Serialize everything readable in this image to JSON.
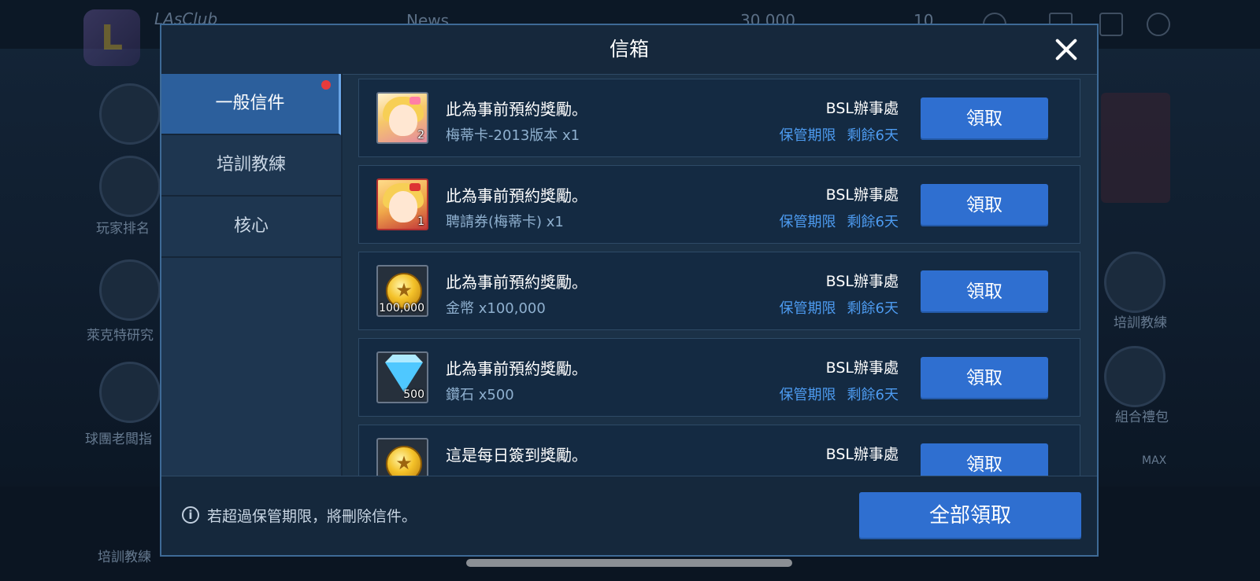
{
  "background": {
    "club_name": "LAsClub",
    "news_label": "News",
    "coins_value": "30,000",
    "gems_value": "10",
    "left_menu": [
      "玩家排名",
      "萊克特研究",
      "球團老闆指"
    ],
    "right_menu": [
      "培訓教練",
      "組合禮包"
    ],
    "bottom_menu": [
      "培訓教練"
    ],
    "max_badge": "MAX"
  },
  "modal": {
    "title": "信箱",
    "tabs": [
      {
        "label": "一般信件",
        "active": true,
        "has_notification": true
      },
      {
        "label": "培訓教練",
        "active": false,
        "has_notification": false
      },
      {
        "label": "核心",
        "active": false,
        "has_notification": false
      }
    ],
    "mails": [
      {
        "icon": "character-card-icon",
        "title": "此為事前預約獎勵。",
        "item": "梅蒂卡-2013版本 x1",
        "quantity_badge": "2",
        "sender": "BSL辦事處",
        "expiry_label": "保管期限",
        "expiry_remaining": "剩餘6天",
        "claim_label": "領取"
      },
      {
        "icon": "recruit-ticket-icon",
        "title": "此為事前預約獎勵。",
        "item": "聘請券(梅蒂卡) x1",
        "quantity_badge": "1",
        "sender": "BSL辦事處",
        "expiry_label": "保管期限",
        "expiry_remaining": "剩餘6天",
        "claim_label": "領取"
      },
      {
        "icon": "gold-coin-icon",
        "title": "此為事前預約獎勵。",
        "item": "金幣 x100,000",
        "quantity_badge": "100,000",
        "sender": "BSL辦事處",
        "expiry_label": "保管期限",
        "expiry_remaining": "剩餘6天",
        "claim_label": "領取"
      },
      {
        "icon": "diamond-icon",
        "title": "此為事前預約獎勵。",
        "item": "鑽石 x500",
        "quantity_badge": "500",
        "sender": "BSL辦事處",
        "expiry_label": "保管期限",
        "expiry_remaining": "剩餘6天",
        "claim_label": "領取"
      },
      {
        "icon": "gold-coin-icon",
        "title": "這是每日簽到獎勵。",
        "item": "",
        "quantity_badge": "",
        "sender": "BSL辦事處",
        "expiry_label": "",
        "expiry_remaining": "",
        "claim_label": "領取"
      }
    ],
    "footer_note": "若超過保管期限，將刪除信件。",
    "claim_all_label": "全部領取",
    "accent_color": "#2f6fd0"
  }
}
